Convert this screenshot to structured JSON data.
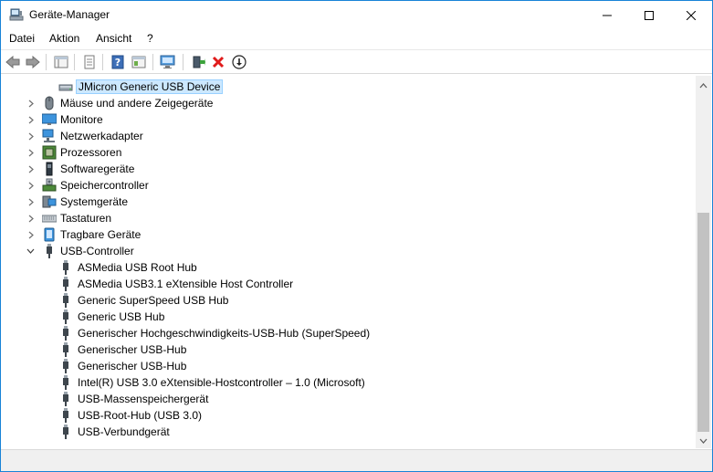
{
  "window": {
    "title": "Geräte-Manager"
  },
  "menu": [
    "Datei",
    "Aktion",
    "Ansicht",
    "?"
  ],
  "toolbar": {
    "buttons": [
      "back-arrow-icon",
      "forward-arrow-icon",
      "properties-icon",
      "update-icon",
      "help-icon",
      "view-icon",
      "monitor-scan-icon",
      "enable-device-icon",
      "uninstall-icon",
      "download-driver-icon"
    ]
  },
  "tree": {
    "items": [
      {
        "label": "JMicron Generic USB Device",
        "icon": "disk-icon",
        "level": 2,
        "selected": true
      },
      {
        "label": "Mäuse und andere Zeigegeräte",
        "icon": "mouse-icon",
        "level": 1,
        "collapsed": true
      },
      {
        "label": "Monitore",
        "icon": "monitor-icon",
        "level": 1,
        "collapsed": true
      },
      {
        "label": "Netzwerkadapter",
        "icon": "network-icon",
        "level": 1,
        "collapsed": true
      },
      {
        "label": "Prozessoren",
        "icon": "cpu-icon",
        "level": 1,
        "collapsed": true
      },
      {
        "label": "Softwaregeräte",
        "icon": "software-icon",
        "level": 1,
        "collapsed": true
      },
      {
        "label": "Speichercontroller",
        "icon": "storage-controller-icon",
        "level": 1,
        "collapsed": true
      },
      {
        "label": "Systemgeräte",
        "icon": "system-icon",
        "level": 1,
        "collapsed": true
      },
      {
        "label": "Tastaturen",
        "icon": "keyboard-icon",
        "level": 1,
        "collapsed": true
      },
      {
        "label": "Tragbare Geräte",
        "icon": "portable-icon",
        "level": 1,
        "collapsed": true
      },
      {
        "label": "USB-Controller",
        "icon": "usb-icon",
        "level": 1,
        "expanded": true
      },
      {
        "label": "ASMedia USB Root Hub",
        "icon": "usb-icon",
        "level": 2
      },
      {
        "label": "ASMedia USB3.1 eXtensible Host Controller",
        "icon": "usb-icon",
        "level": 2
      },
      {
        "label": "Generic SuperSpeed USB Hub",
        "icon": "usb-icon",
        "level": 2
      },
      {
        "label": "Generic USB Hub",
        "icon": "usb-icon",
        "level": 2
      },
      {
        "label": "Generischer Hochgeschwindigkeits-USB-Hub (SuperSpeed)",
        "icon": "usb-icon",
        "level": 2
      },
      {
        "label": "Generischer USB-Hub",
        "icon": "usb-icon",
        "level": 2
      },
      {
        "label": "Generischer USB-Hub",
        "icon": "usb-icon",
        "level": 2
      },
      {
        "label": "Intel(R) USB 3.0 eXtensible-Hostcontroller – 1.0 (Microsoft)",
        "icon": "usb-icon",
        "level": 2
      },
      {
        "label": "USB-Massenspeichergerät",
        "icon": "usb-icon",
        "level": 2
      },
      {
        "label": "USB-Root-Hub (USB 3.0)",
        "icon": "usb-icon",
        "level": 2
      },
      {
        "label": "USB-Verbundgerät",
        "icon": "usb-icon",
        "level": 2
      }
    ]
  },
  "colors": {
    "accent": "#1883d7",
    "selection_bg": "#cce8ff",
    "selection_border": "#99d1ff"
  }
}
